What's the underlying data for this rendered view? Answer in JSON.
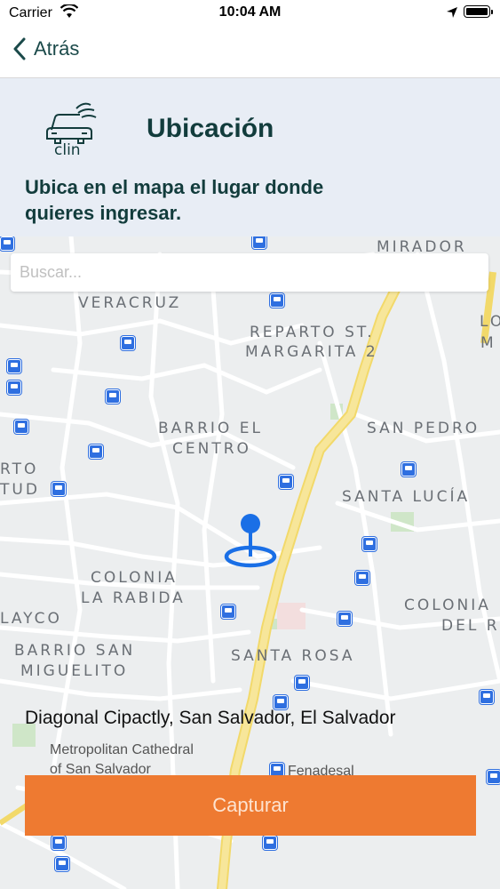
{
  "status_bar": {
    "carrier": "Carrier",
    "time": "10:04 AM"
  },
  "nav": {
    "back_label": "Atrás"
  },
  "header": {
    "logo_text": "clin",
    "title": "Ubicación",
    "subtitle": "Ubica en el mapa el lugar donde quieres ingresar."
  },
  "search": {
    "placeholder": "Buscar...",
    "value": ""
  },
  "map": {
    "labels": {
      "mirador": "MIRADOR",
      "veracruz": "VERACRUZ",
      "reparto_1": "REPARTO ST.",
      "reparto_2": "MARGARITA 2",
      "lot_1": "LOT",
      "lot_2": "M",
      "barrio_centro_1": "BARRIO EL",
      "barrio_centro_2": "CENTRO",
      "san_pedro": "SAN PEDRO",
      "rto": "RTO",
      "tud": "TUD",
      "santa_lucia": "SANTA LUCÍA",
      "colonia_rabida_1": "COLONIA",
      "colonia_rabida_2": "LA RABIDA",
      "colonia_rey_1": "COLONIA",
      "colonia_rey_2": "DEL R",
      "layco": "LAYCO",
      "barrio_san_1": "BARRIO SAN",
      "barrio_san_2": "MIGUELITO",
      "santa_rosa": "SANTA ROSA"
    },
    "pois": {
      "cathedral_1": "Metropolitan Cathedral",
      "cathedral_2": "of San Salvador",
      "fenadesal": "Fenadesal"
    }
  },
  "address": "Diagonal Cipactly, San Salvador, El Salvador",
  "capture_button": {
    "label": "Capturar"
  },
  "colors": {
    "primary": "#123c3c",
    "accent": "#ee7a31",
    "header_bg": "#e8edf5",
    "pin": "#1a6fe6"
  }
}
